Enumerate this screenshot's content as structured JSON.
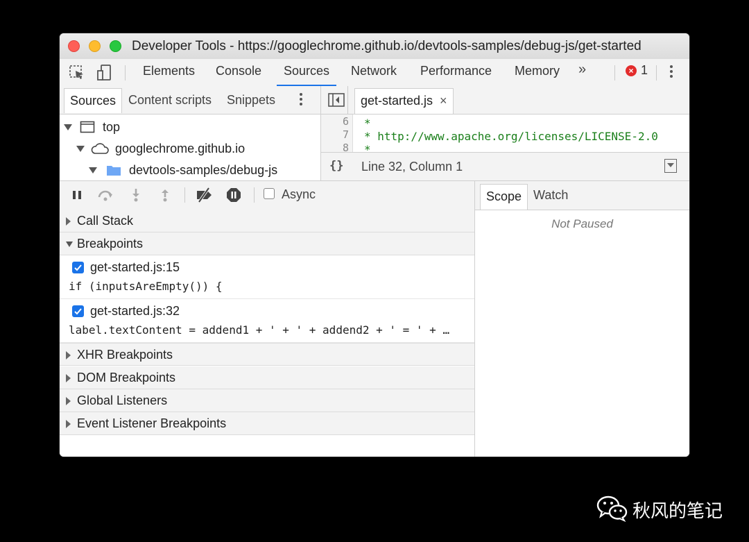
{
  "window": {
    "title": "Developer Tools - https://googlechrome.github.io/devtools-samples/debug-js/get-started"
  },
  "main_tabs": {
    "items": [
      "Elements",
      "Console",
      "Sources",
      "Network",
      "Performance",
      "Memory"
    ],
    "active": "Sources",
    "more": "»",
    "error_count": "1"
  },
  "navigator": {
    "tabs": [
      "Sources",
      "Content scripts",
      "Snippets"
    ],
    "tree": [
      "top",
      "googlechrome.github.io",
      "devtools-samples/debug-js"
    ]
  },
  "editor": {
    "file_tab": "get-started.js",
    "close": "×",
    "lines": [
      {
        "num": "6",
        "text": "*"
      },
      {
        "num": "7",
        "text": "* http://www.apache.org/licenses/LICENSE-2.0"
      },
      {
        "num": "8",
        "text": "*"
      }
    ],
    "format_icon": "{}",
    "status": "Line 32, Column 1"
  },
  "debugger": {
    "async_label": "Async",
    "sections": {
      "call_stack": "Call Stack",
      "breakpoints": "Breakpoints",
      "xhr": "XHR Breakpoints",
      "dom": "DOM Breakpoints",
      "global": "Global Listeners",
      "event": "Event Listener Breakpoints"
    },
    "breakpoints": [
      {
        "file": "get-started.js:15",
        "code": "if (inputsAreEmpty()) {",
        "checked": true
      },
      {
        "file": "get-started.js:32",
        "code": "label.textContent = addend1 + ' + ' + addend2 + ' = ' + …",
        "checked": true
      }
    ]
  },
  "scope": {
    "tabs": [
      "Scope",
      "Watch"
    ],
    "status": "Not Paused"
  },
  "watermark": {
    "text": "秋风的笔记"
  },
  "colors": {
    "accent": "#1a73e8",
    "error": "#e32c2c",
    "code_comment": "#1a7f1a"
  }
}
